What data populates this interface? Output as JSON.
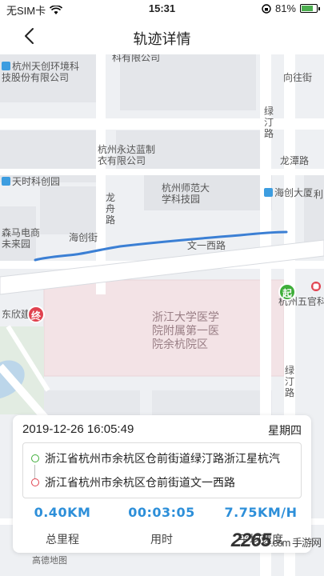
{
  "status_bar": {
    "carrier": "无SIM卡",
    "time": "15:31",
    "battery": "81%"
  },
  "nav": {
    "title": "轨迹详情"
  },
  "map": {
    "labels": {
      "tianchuang": "杭州天创环境科\n技股份有限公司",
      "keji": "科有限公司",
      "xiangwangjie": "向往街",
      "lvtinglu_top": "绿汀路",
      "yongda": "杭州永达蓝制\n衣有限公司",
      "longtanlu": "龙潭路",
      "tianshi": "天时科创园",
      "shifan": "杭州师范大\n学科技园",
      "haichuang": "海创大厦",
      "li": "利",
      "longzhoulu": "龙舟路",
      "senma": "森马电商\n未来园",
      "haichuangjie": "海创街",
      "wenyixilu": "文一西路",
      "wuguan": "杭州五官科",
      "dongxin": "东欣建设",
      "hospital": "浙江大学医学\n院附属第一医\n院余杭院区",
      "lvtinglu_bottom": "绿汀路",
      "amap": "高德地图"
    },
    "start_marker": "起",
    "end_marker": "终"
  },
  "trip": {
    "datetime": "2019-12-26 16:05:49",
    "weekday": "星期四",
    "start_address": "浙江省杭州市余杭区仓前街道绿汀路浙江星杭汽",
    "end_address": "浙江省杭州市余杭区仓前街道文一西路"
  },
  "stats": [
    {
      "value": "0.40KM",
      "label": "总里程"
    },
    {
      "value": "00:03:05",
      "label": "用时"
    },
    {
      "value": "7.75KM/H",
      "label": "平均速度"
    }
  ],
  "watermark": {
    "brand": "2265",
    "suffix": ".com 手游网"
  },
  "colors": {
    "accent": "#2d8fd9",
    "start": "#3fae3a",
    "end": "#e0424f",
    "route": "#3b7fd4"
  }
}
